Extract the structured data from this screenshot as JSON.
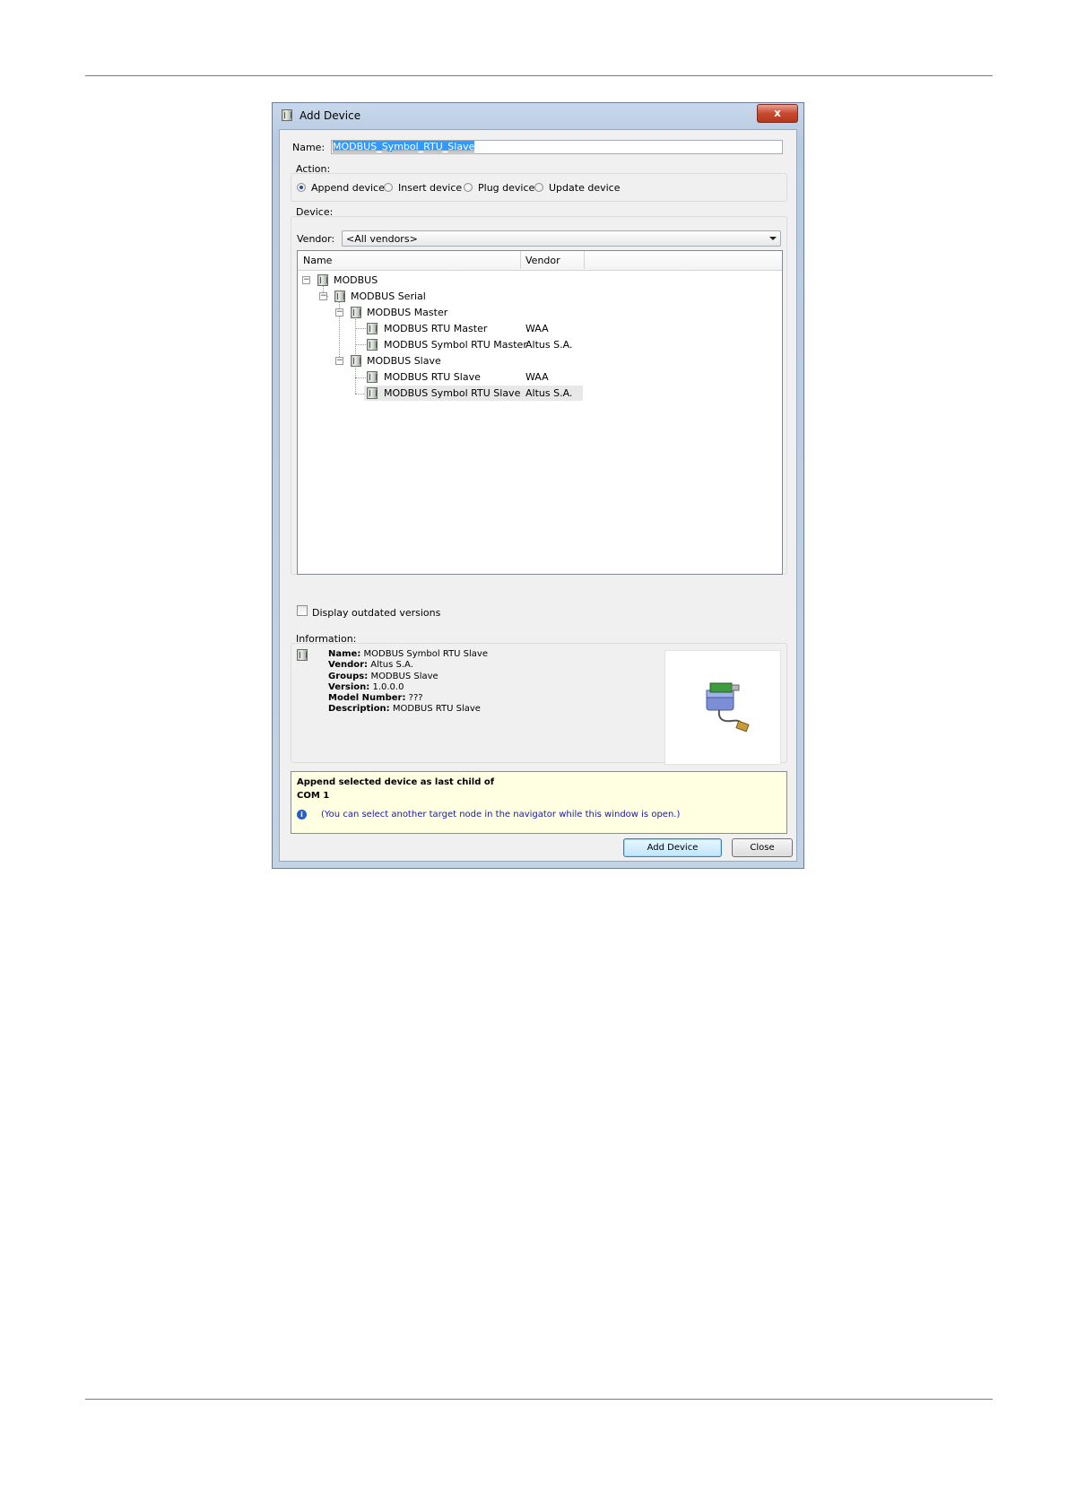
{
  "window": {
    "title": "Add Device",
    "close_glyph": "x"
  },
  "name_field": {
    "label": "Name:",
    "value": "MODBUS_Symbol_RTU_Slave"
  },
  "action": {
    "label": "Action:",
    "options": [
      {
        "label": "Append device",
        "selected": true
      },
      {
        "label": "Insert device",
        "selected": false
      },
      {
        "label": "Plug device",
        "selected": false
      },
      {
        "label": "Update device",
        "selected": false
      }
    ]
  },
  "device": {
    "label": "Device:",
    "vendor_label": "Vendor:",
    "vendor_value": "<All vendors>",
    "columns": [
      "Name",
      "Vendor"
    ],
    "tree": [
      {
        "name": "MODBUS",
        "vendor": ""
      },
      {
        "name": "MODBUS Serial",
        "vendor": ""
      },
      {
        "name": "MODBUS Master",
        "vendor": ""
      },
      {
        "name": "MODBUS RTU Master",
        "vendor": "WAA"
      },
      {
        "name": "MODBUS Symbol RTU Master",
        "vendor": "Altus S.A."
      },
      {
        "name": "MODBUS Slave",
        "vendor": ""
      },
      {
        "name": "MODBUS RTU Slave",
        "vendor": "WAA"
      },
      {
        "name": "MODBUS Symbol RTU Slave",
        "vendor": "Altus S.A.",
        "selected": true
      }
    ],
    "outdated_label": "Display outdated versions"
  },
  "information": {
    "label": "Information:",
    "fields": [
      {
        "key": "Name:",
        "value": "MODBUS Symbol RTU Slave"
      },
      {
        "key": "Vendor:",
        "value": "Altus S.A."
      },
      {
        "key": "Groups:",
        "value": "MODBUS Slave"
      },
      {
        "key": "Version:",
        "value": "1.0.0.0"
      },
      {
        "key": "Model Number:",
        "value": "???"
      },
      {
        "key": "Description:",
        "value": "MODBUS RTU Slave"
      }
    ]
  },
  "message": {
    "line1": "Append selected device as last child of",
    "line2": "COM 1",
    "hint": "(You can select another target node in the navigator while this window is open.)"
  },
  "buttons": {
    "add": "Add Device",
    "close": "Close"
  },
  "colors": {
    "selection": "#3399ff",
    "hint_text": "#1a1aa6",
    "message_bg": "#ffffe1"
  }
}
